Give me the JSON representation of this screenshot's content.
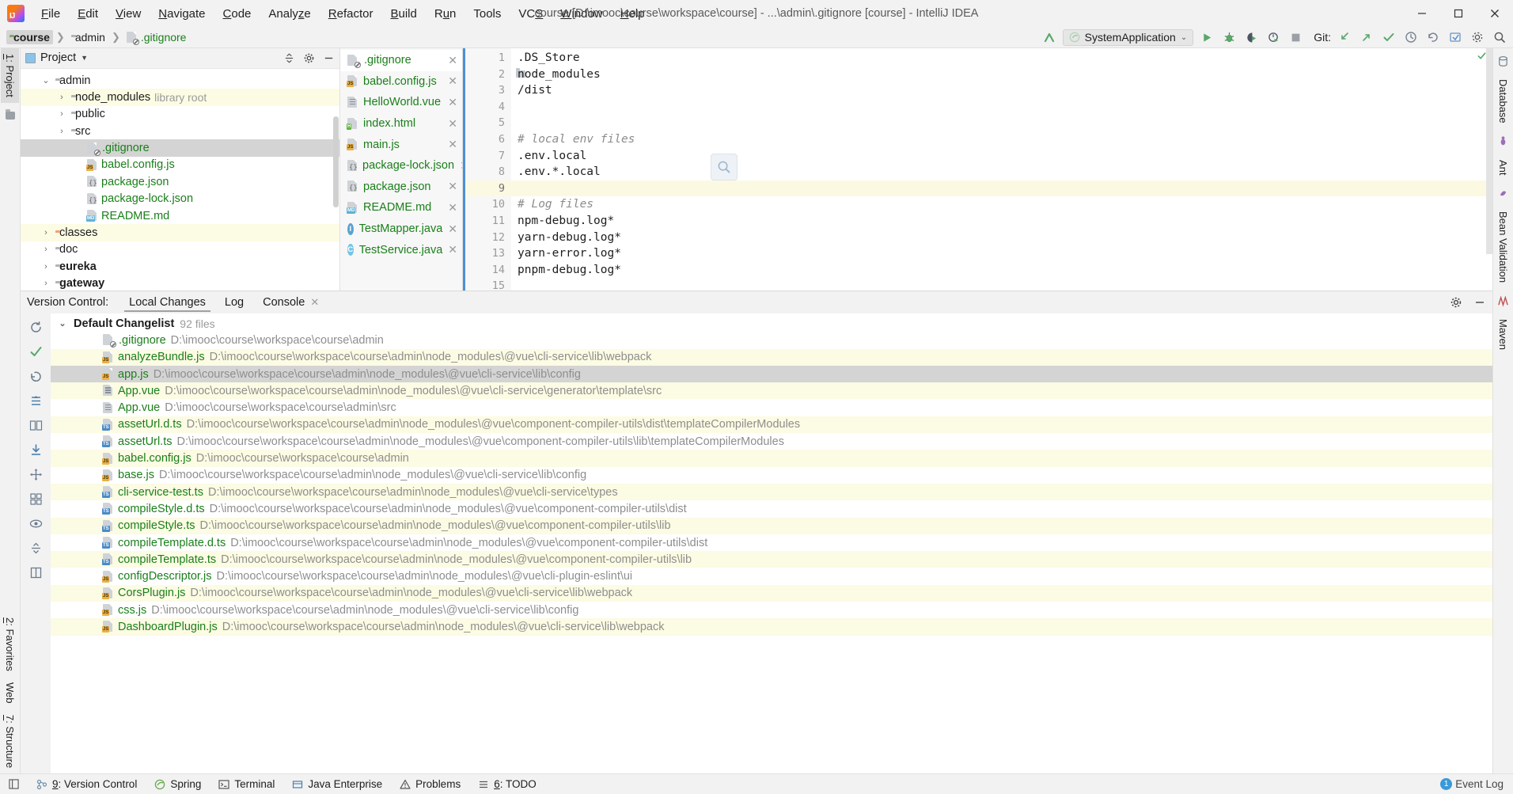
{
  "window": {
    "title": "course [D:\\imooc\\course\\workspace\\course] - ...\\admin\\.gitignore [course] - IntelliJ IDEA",
    "minimize": "—",
    "maximize": "▢",
    "close": "✕"
  },
  "menu": [
    "File",
    "Edit",
    "View",
    "Navigate",
    "Code",
    "Analyze",
    "Refactor",
    "Build",
    "Run",
    "Tools",
    "VCS",
    "Window",
    "Help"
  ],
  "breadcrumb": [
    {
      "label": "course",
      "icon": "folder-green-icon"
    },
    {
      "label": "admin",
      "icon": "folder-icon"
    },
    {
      "label": ".gitignore",
      "icon": "gitignore-file-icon"
    }
  ],
  "toolbar": {
    "run_config": "SystemApplication",
    "run_config_caret": "⌄",
    "git_label": "Git:",
    "icons": [
      "build-icon",
      "run-icon",
      "debug-icon",
      "run-coverage-icon",
      "profiler-icon",
      "stop-icon",
      "rollback-icon",
      "push-icon",
      "commit-icon",
      "history-icon",
      "undo-icon",
      "update-icon",
      "settings-icon",
      "search-everywhere-icon"
    ]
  },
  "left_rail": {
    "project_tab": "1: Project",
    "favorites_tab": "2: Favorites",
    "structure_tab": "7: Structure",
    "web_tab": "Web"
  },
  "right_rail": {
    "items": [
      "Database",
      "Ant",
      "Bean Validation",
      "Maven"
    ]
  },
  "project_panel": {
    "title": "Project",
    "caret": "▾",
    "actions": [
      "collapse-all-icon",
      "settings-icon",
      "hide-icon"
    ],
    "tree": [
      {
        "label": "admin",
        "arrow": "⌄",
        "indent": 1,
        "icon": "folder-icon",
        "state": "normal",
        "color": "black"
      },
      {
        "label": "node_modules",
        "suffix": "library root",
        "arrow": "›",
        "indent": 2,
        "icon": "folder-icon",
        "state": "mod",
        "color": "black"
      },
      {
        "label": "public",
        "arrow": "›",
        "indent": 2,
        "icon": "folder-icon",
        "state": "normal",
        "color": "black"
      },
      {
        "label": "src",
        "arrow": "›",
        "indent": 2,
        "icon": "folder-icon",
        "state": "normal",
        "color": "black"
      },
      {
        "label": ".gitignore",
        "arrow": "",
        "indent": 3,
        "icon": "gitignore-file-icon",
        "state": "sel",
        "color": "green"
      },
      {
        "label": "babel.config.js",
        "arrow": "",
        "indent": 3,
        "icon": "js-file-icon",
        "state": "normal",
        "color": "green"
      },
      {
        "label": "package.json",
        "arrow": "",
        "indent": 3,
        "icon": "json-file-icon",
        "state": "normal",
        "color": "green"
      },
      {
        "label": "package-lock.json",
        "arrow": "",
        "indent": 3,
        "icon": "json-file-icon",
        "state": "normal",
        "color": "green"
      },
      {
        "label": "README.md",
        "arrow": "",
        "indent": 3,
        "icon": "md-file-icon",
        "state": "normal",
        "color": "green"
      },
      {
        "label": "classes",
        "arrow": "›",
        "indent": 1,
        "icon": "folder-orange-icon",
        "state": "mod",
        "color": "black"
      },
      {
        "label": "doc",
        "arrow": "›",
        "indent": 1,
        "icon": "folder-icon",
        "state": "normal",
        "color": "black"
      },
      {
        "label": "eureka",
        "arrow": "›",
        "indent": 1,
        "icon": "folder-icon",
        "state": "normal",
        "color": "black",
        "bold": true
      },
      {
        "label": "gateway",
        "arrow": "›",
        "indent": 1,
        "icon": "folder-icon",
        "state": "normal",
        "color": "black",
        "bold": true
      }
    ]
  },
  "tab_list": [
    {
      "label": ".gitignore",
      "icon": "gitignore-file-icon",
      "active": true,
      "close": "✕"
    },
    {
      "label": "babel.config.js",
      "icon": "js-file-icon",
      "active": false,
      "close": "✕"
    },
    {
      "label": "HelloWorld.vue",
      "icon": "vue-file-icon",
      "active": false,
      "close": "✕"
    },
    {
      "label": "index.html",
      "icon": "html-file-icon",
      "active": false,
      "close": "✕"
    },
    {
      "label": "main.js",
      "icon": "js-file-icon",
      "active": false,
      "close": "✕"
    },
    {
      "label": "package-lock.json",
      "icon": "json-file-icon",
      "active": false,
      "close": "✕"
    },
    {
      "label": "package.json",
      "icon": "json-file-icon",
      "active": false,
      "close": "✕"
    },
    {
      "label": "README.md",
      "icon": "md-file-icon",
      "active": false,
      "close": "✕"
    },
    {
      "label": "TestMapper.java",
      "icon": "java-interface-icon",
      "active": false,
      "close": "✕"
    },
    {
      "label": "TestService.java",
      "icon": "java-class-icon",
      "active": false,
      "close": "✕"
    }
  ],
  "editor": {
    "lines": [
      {
        "n": "1",
        "text": ".DS_Store",
        "type": "code",
        "fold": false
      },
      {
        "n": "2",
        "text": "node_modules",
        "type": "code",
        "fold": true
      },
      {
        "n": "3",
        "text": "/dist",
        "type": "code",
        "fold": false
      },
      {
        "n": "4",
        "text": "",
        "type": "code",
        "fold": false
      },
      {
        "n": "5",
        "text": "",
        "type": "code",
        "fold": false
      },
      {
        "n": "6",
        "text": "# local env files",
        "type": "comment",
        "fold": false
      },
      {
        "n": "7",
        "text": ".env.local",
        "type": "code",
        "fold": false
      },
      {
        "n": "8",
        "text": ".env.*.local",
        "type": "code",
        "fold": false
      },
      {
        "n": "9",
        "text": "",
        "type": "code",
        "fold": false,
        "current": true
      },
      {
        "n": "10",
        "text": "# Log files",
        "type": "comment",
        "fold": false
      },
      {
        "n": "11",
        "text": "npm-debug.log*",
        "type": "code",
        "fold": false
      },
      {
        "n": "12",
        "text": "yarn-debug.log*",
        "type": "code",
        "fold": false
      },
      {
        "n": "13",
        "text": "yarn-error.log*",
        "type": "code",
        "fold": false
      },
      {
        "n": "14",
        "text": "pnpm-debug.log*",
        "type": "code",
        "fold": false
      },
      {
        "n": "15",
        "text": "",
        "type": "code",
        "fold": false
      }
    ]
  },
  "vcs": {
    "label": "Version Control:",
    "tabs": [
      {
        "label": "Local Changes",
        "selected": true,
        "close": ""
      },
      {
        "label": "Log",
        "selected": false,
        "close": ""
      },
      {
        "label": "Console",
        "selected": false,
        "close": "✕"
      }
    ],
    "changelist": {
      "name": "Default Changelist",
      "count": "92 files",
      "arrow": "⌄"
    },
    "rows": [
      {
        "name": ".gitignore",
        "path": "D:\\imooc\\course\\workspace\\course\\admin",
        "icon": "gitignore-file-icon",
        "state": "normal"
      },
      {
        "name": "analyzeBundle.js",
        "path": "D:\\imooc\\course\\workspace\\course\\admin\\node_modules\\@vue\\cli-service\\lib\\webpack",
        "icon": "js-file-icon",
        "state": "mod"
      },
      {
        "name": "app.js",
        "path": "D:\\imooc\\course\\workspace\\course\\admin\\node_modules\\@vue\\cli-service\\lib\\config",
        "icon": "js-file-icon",
        "state": "sel"
      },
      {
        "name": "App.vue",
        "path": "D:\\imooc\\course\\workspace\\course\\admin\\node_modules\\@vue\\cli-service\\generator\\template\\src",
        "icon": "vue-file-icon",
        "state": "mod"
      },
      {
        "name": "App.vue",
        "path": "D:\\imooc\\course\\workspace\\course\\admin\\src",
        "icon": "vue-file-icon",
        "state": "normal"
      },
      {
        "name": "assetUrl.d.ts",
        "path": "D:\\imooc\\course\\workspace\\course\\admin\\node_modules\\@vue\\component-compiler-utils\\dist\\templateCompilerModules",
        "icon": "ts-file-icon",
        "state": "mod"
      },
      {
        "name": "assetUrl.ts",
        "path": "D:\\imooc\\course\\workspace\\course\\admin\\node_modules\\@vue\\component-compiler-utils\\lib\\templateCompilerModules",
        "icon": "ts-file-icon",
        "state": "normal"
      },
      {
        "name": "babel.config.js",
        "path": "D:\\imooc\\course\\workspace\\course\\admin",
        "icon": "js-file-icon",
        "state": "mod"
      },
      {
        "name": "base.js",
        "path": "D:\\imooc\\course\\workspace\\course\\admin\\node_modules\\@vue\\cli-service\\lib\\config",
        "icon": "js-file-icon",
        "state": "normal"
      },
      {
        "name": "cli-service-test.ts",
        "path": "D:\\imooc\\course\\workspace\\course\\admin\\node_modules\\@vue\\cli-service\\types",
        "icon": "ts-file-icon",
        "state": "mod"
      },
      {
        "name": "compileStyle.d.ts",
        "path": "D:\\imooc\\course\\workspace\\course\\admin\\node_modules\\@vue\\component-compiler-utils\\dist",
        "icon": "ts-file-icon",
        "state": "normal"
      },
      {
        "name": "compileStyle.ts",
        "path": "D:\\imooc\\course\\workspace\\course\\admin\\node_modules\\@vue\\component-compiler-utils\\lib",
        "icon": "ts-file-icon",
        "state": "mod"
      },
      {
        "name": "compileTemplate.d.ts",
        "path": "D:\\imooc\\course\\workspace\\course\\admin\\node_modules\\@vue\\component-compiler-utils\\dist",
        "icon": "ts-file-icon",
        "state": "normal"
      },
      {
        "name": "compileTemplate.ts",
        "path": "D:\\imooc\\course\\workspace\\course\\admin\\node_modules\\@vue\\component-compiler-utils\\lib",
        "icon": "ts-file-icon",
        "state": "mod"
      },
      {
        "name": "configDescriptor.js",
        "path": "D:\\imooc\\course\\workspace\\course\\admin\\node_modules\\@vue\\cli-plugin-eslint\\ui",
        "icon": "js-file-icon",
        "state": "normal"
      },
      {
        "name": "CorsPlugin.js",
        "path": "D:\\imooc\\course\\workspace\\course\\admin\\node_modules\\@vue\\cli-service\\lib\\webpack",
        "icon": "js-file-icon",
        "state": "mod"
      },
      {
        "name": "css.js",
        "path": "D:\\imooc\\course\\workspace\\course\\admin\\node_modules\\@vue\\cli-service\\lib\\config",
        "icon": "js-file-icon",
        "state": "normal"
      },
      {
        "name": "DashboardPlugin.js",
        "path": "D:\\imooc\\course\\workspace\\course\\admin\\node_modules\\@vue\\cli-service\\lib\\webpack",
        "icon": "js-file-icon",
        "state": "mod"
      }
    ]
  },
  "status_bar": {
    "items": [
      {
        "label": "9: Version Control",
        "icon": "version-control-icon",
        "underline": "9"
      },
      {
        "label": "Spring",
        "icon": "spring-icon",
        "underline": ""
      },
      {
        "label": "Terminal",
        "icon": "terminal-icon",
        "underline": ""
      },
      {
        "label": "Java Enterprise",
        "icon": "java-enterprise-icon",
        "underline": ""
      },
      {
        "label": "Problems",
        "icon": "problems-icon",
        "underline": ""
      },
      {
        "label": "6: TODO",
        "icon": "todo-icon",
        "underline": "6"
      }
    ],
    "event_log": "Event Log",
    "event_log_icon": "bell-icon"
  },
  "colors": {
    "accent": "#4a90d9",
    "file_green": "#1a7f1a",
    "modified_bg": "#fcfbe3",
    "selected_bg": "#d4d4d4",
    "panel_bg": "#f2f2f2"
  }
}
